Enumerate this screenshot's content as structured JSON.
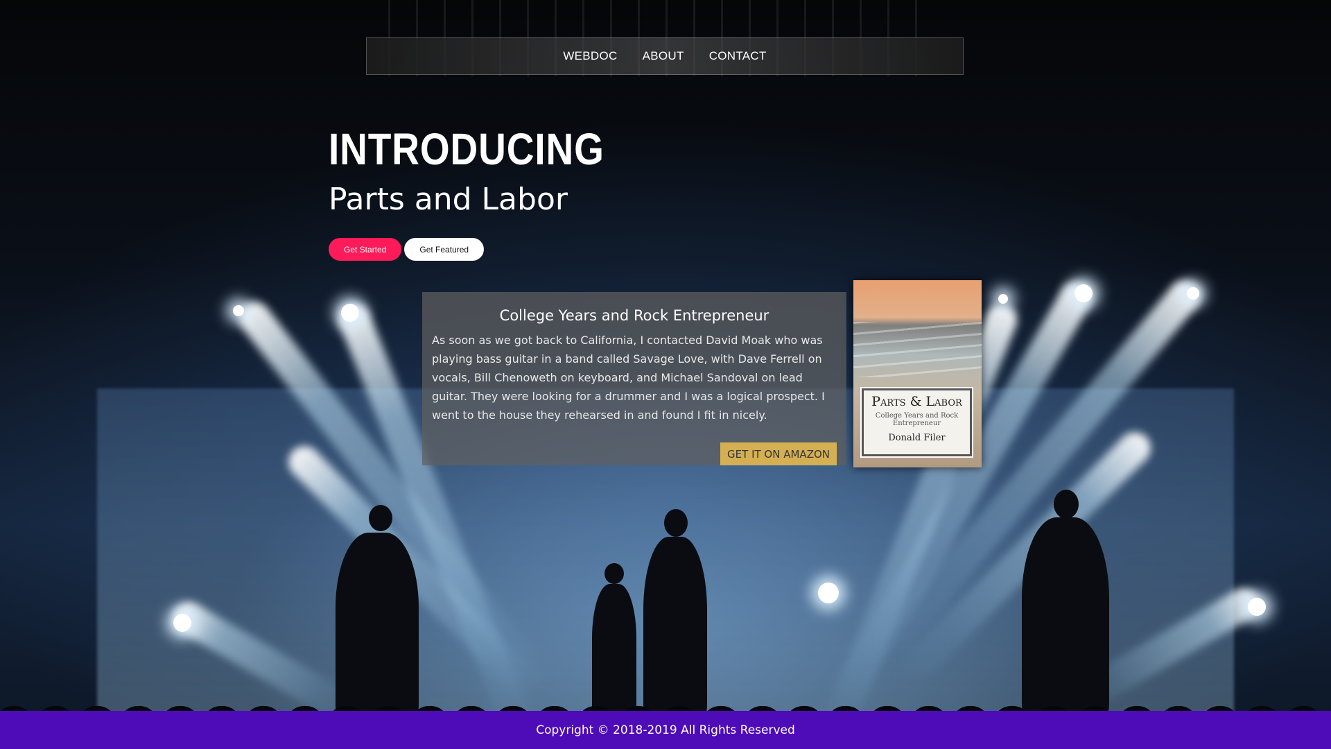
{
  "nav": {
    "items": [
      {
        "label": "WEBDOC"
      },
      {
        "label": "ABOUT"
      },
      {
        "label": "CONTACT"
      }
    ]
  },
  "hero": {
    "title": "INTRODUCING",
    "subtitle": "Parts and Labor",
    "primary_button": "Get Started",
    "secondary_button": "Get Featured"
  },
  "card": {
    "heading": "College Years and Rock Entrepreneur",
    "body": "As soon as we got back to California, I contacted David Moak who was playing bass guitar in a band called Savage Love, with Dave Ferrell on vocals, Bill Chenoweth on keyboard, and Michael Sandoval on lead guitar. They were looking for a drummer and I was a logical prospect. I went to the house they rehearsed in and found I fit in nicely.",
    "cta": "GET IT ON AMAZON"
  },
  "book": {
    "title": "Parts & Labor",
    "subtitle": "College Years and Rock Entrepreneur",
    "author": "Donald Filer"
  },
  "footer": {
    "copyright": "Copyright © 2018-2019 All Rights Reserved"
  },
  "colors": {
    "primary_button": "#ff1a5a",
    "footer": "#4e0bb8",
    "cta": "#d4b052"
  }
}
